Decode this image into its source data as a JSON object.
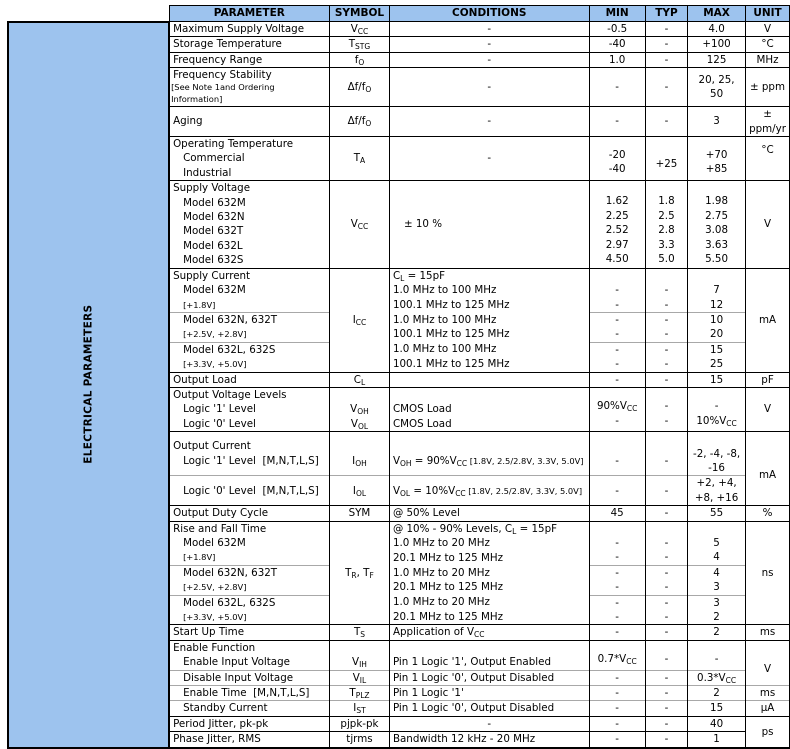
{
  "header": {
    "parameter": "PARAMETER",
    "symbol": "SYMBOL",
    "conditions": "CONDITIONS",
    "min": "MIN",
    "typ": "TYP",
    "max": "MAX",
    "unit": "UNIT"
  },
  "section_label": "ELECTRICAL PARAMETERS",
  "colors": {
    "header_bg": "#9dc3ee",
    "border": "#000000",
    "sub_divider": "#a8a8a8"
  },
  "rows": {
    "max_supply": {
      "param": "Maximum Supply Voltage",
      "sym": "V",
      "sym_sub": "CC",
      "cond": "-",
      "min": "-0.5",
      "typ": "-",
      "max": "4.0",
      "unit": "V"
    },
    "storage_temp": {
      "param": "Storage Temperature",
      "sym": "T",
      "sym_sub": "STG",
      "cond": "-",
      "min": "-40",
      "typ": "-",
      "max": "+100",
      "unit": "°C"
    },
    "freq_range": {
      "param": "Frequency Range",
      "sym": "f",
      "sym_sub": "O",
      "cond": "-",
      "min": "1.0",
      "typ": "-",
      "max": "125",
      "unit": "MHz"
    },
    "freq_stab": {
      "param": "Frequency Stability",
      "note": "[See Note 1and Ordering Information]",
      "sym": "Δf/f",
      "sym_sub": "O",
      "cond": "-",
      "min": "-",
      "typ": "-",
      "max": "20, 25, 50",
      "unit": "± ppm"
    },
    "aging": {
      "param": "Aging",
      "sym": "Δf/f",
      "sym_sub": "O",
      "cond": "-",
      "min": "-",
      "typ": "-",
      "max": "3",
      "unit": "± ppm/yr"
    },
    "op_temp": {
      "param": "Operating Temperature",
      "items": [
        "Commercial",
        "Industrial"
      ],
      "sym": "T",
      "sym_sub": "A",
      "cond": "-",
      "min": [
        "-20",
        "-40"
      ],
      "typ": "+25",
      "max": [
        "+70",
        "+85"
      ],
      "unit": "°C"
    },
    "supply_voltage": {
      "param": "Supply Voltage",
      "models": [
        "Model 632M",
        "Model 632N",
        "Model 632T",
        "Model 632L",
        "Model 632S"
      ],
      "sym": "V",
      "sym_sub": "CC",
      "cond": "± 10 %",
      "min": [
        "1.62",
        "2.25",
        "2.52",
        "2.97",
        "4.50"
      ],
      "typ": [
        "1.8",
        "2.5",
        "2.8",
        "3.3",
        "5.0"
      ],
      "max": [
        "1.98",
        "2.75",
        "3.08",
        "3.63",
        "5.50"
      ],
      "unit": "V"
    },
    "supply_current": {
      "param": "Supply Current",
      "sym": "I",
      "sym_sub": "CC",
      "cond_head": "C",
      "cond_head_sub": "L",
      "cond_head_tail": " = 15pF",
      "unit": "mA",
      "groups": [
        {
          "model": "Model 632M",
          "volt": "[+1.8V]",
          "cond": [
            "1.0 MHz to 100 MHz",
            "100.1 MHz to 125 MHz"
          ],
          "min": [
            "-",
            "-"
          ],
          "typ": [
            "-",
            "-"
          ],
          "max": [
            "7",
            "12"
          ]
        },
        {
          "model": "Model 632N, 632T",
          "volt": "[+2.5V, +2.8V]",
          "cond": [
            "1.0 MHz to 100 MHz",
            "100.1 MHz to 125 MHz"
          ],
          "min": [
            "-",
            "-"
          ],
          "typ": [
            "-",
            "-"
          ],
          "max": [
            "10",
            "20"
          ]
        },
        {
          "model": "Model 632L, 632S",
          "volt": "[+3.3V, +5.0V]",
          "cond": [
            "1.0 MHz to 100 MHz",
            "100.1 MHz to 125 MHz"
          ],
          "min": [
            "-",
            "-"
          ],
          "typ": [
            "-",
            "-"
          ],
          "max": [
            "15",
            "25"
          ]
        }
      ]
    },
    "output_load": {
      "param": "Output Load",
      "sym": "C",
      "sym_sub": "L",
      "cond": "",
      "min": "-",
      "typ": "-",
      "max": "15",
      "unit": "pF"
    },
    "output_voltage": {
      "param": "Output Voltage Levels",
      "unit": "V",
      "items": [
        {
          "label": "Logic '1' Level",
          "sym": "V",
          "sym_sub": "OH",
          "cond": "CMOS Load",
          "min": "90%V",
          "min_sub": "CC",
          "typ": "-",
          "max": "-",
          "max_sub": ""
        },
        {
          "label": "Logic '0' Level",
          "sym": "V",
          "sym_sub": "OL",
          "cond": "CMOS Load",
          "min": "-",
          "min_sub": "",
          "typ": "-",
          "max": "10%V",
          "max_sub": "CC"
        }
      ]
    },
    "output_current": {
      "param": "Output Current",
      "unit": "mA",
      "items": [
        {
          "label": "Logic '1' Level  [M,N,T,L,S]",
          "sym": "I",
          "sym_sub": "OH",
          "cond_a": "V",
          "cond_a_sub": "OH",
          "cond_b": " = 90%V",
          "cond_b_sub": "CC",
          "cond_note": " [1.8V, 2.5/2.8V, 3.3V, 5.0V]",
          "min": "-",
          "typ": "-",
          "max": "-2, -4, -8, -16"
        },
        {
          "label": "Logic '0' Level  [M,N,T,L,S]",
          "sym": "I",
          "sym_sub": "OL",
          "cond_a": "V",
          "cond_a_sub": "OL",
          "cond_b": " = 10%V",
          "cond_b_sub": "CC",
          "cond_note": " [1.8V, 2.5/2.8V, 3.3V, 5.0V]",
          "min": "-",
          "typ": "-",
          "max": "+2, +4, +8, +16"
        }
      ]
    },
    "duty_cycle": {
      "param": "Output Duty Cycle",
      "sym": "SYM",
      "cond": "@ 50% Level",
      "min": "45",
      "typ": "-",
      "max": "55",
      "unit": "%"
    },
    "rise_fall": {
      "param": "Rise and Fall Time",
      "sym": "T",
      "sym_sub": "R",
      "sym_mid": ", T",
      "sym_sub2": "F",
      "cond_head": "@ 10% - 90% Levels, C",
      "cond_head_sub": "L",
      "cond_head_tail": " = 15pF",
      "unit": "ns",
      "groups": [
        {
          "model": "Model 632M",
          "volt": "[+1.8V]",
          "cond": [
            "1.0 MHz to 20 MHz",
            "20.1 MHz to 125 MHz"
          ],
          "min": [
            "-",
            "-"
          ],
          "typ": [
            "-",
            "-"
          ],
          "max": [
            "5",
            "4"
          ]
        },
        {
          "model": "Model 632N, 632T",
          "volt": "[+2.5V, +2.8V]",
          "cond": [
            "1.0 MHz to 20 MHz",
            "20.1 MHz to 125 MHz"
          ],
          "min": [
            "-",
            "-"
          ],
          "typ": [
            "-",
            "-"
          ],
          "max": [
            "4",
            "3"
          ]
        },
        {
          "model": "Model 632L, 632S",
          "volt": "[+3.3V, +5.0V]",
          "cond": [
            "1.0 MHz to 20 MHz",
            "20.1 MHz to 125 MHz"
          ],
          "min": [
            "-",
            "-"
          ],
          "typ": [
            "-",
            "-"
          ],
          "max": [
            "3",
            "2"
          ]
        }
      ]
    },
    "startup": {
      "param": "Start Up Time",
      "sym": "T",
      "sym_sub": "S",
      "cond": "Application of V",
      "cond_sub": "CC",
      "min": "-",
      "typ": "-",
      "max": "2",
      "unit": "ms"
    },
    "enable": {
      "param": "Enable Function",
      "items": [
        {
          "label": "Enable Input Voltage",
          "sym": "V",
          "sym_sub": "IH",
          "cond": "Pin 1 Logic '1', Output Enabled",
          "min": "0.7*V",
          "min_sub": "CC",
          "typ": "-",
          "max": "-",
          "max_sub": "",
          "unit": "V"
        },
        {
          "label": "Disable Input Voltage",
          "sym": "V",
          "sym_sub": "IL",
          "cond": "Pin 1 Logic '0', Output Disabled",
          "min": "-",
          "min_sub": "",
          "typ": "-",
          "max": "0.3*V",
          "max_sub": "CC"
        },
        {
          "label": "Enable Time  [M,N,T,L,S]",
          "sym": "T",
          "sym_sub": "PLZ",
          "cond": "Pin 1 Logic '1'",
          "min": "-",
          "min_sub": "",
          "typ": "-",
          "max": "2",
          "max_sub": "",
          "unit": "ms"
        },
        {
          "label": "Standby Current",
          "sym": "I",
          "sym_sub": "ST",
          "cond": "Pin 1 Logic '0', Output Disabled",
          "min": "-",
          "min_sub": "",
          "typ": "-",
          "max": "15",
          "max_sub": "",
          "unit": "μA"
        }
      ]
    },
    "jitter": {
      "unit": "ps",
      "items": [
        {
          "param": "Period Jitter, pk-pk",
          "sym": "pjpk-pk",
          "cond": "-",
          "min": "-",
          "typ": "-",
          "max": "40"
        },
        {
          "param": "Phase Jitter, RMS",
          "sym": "tjrms",
          "cond": "Bandwidth 12 kHz - 20 MHz",
          "min": "-",
          "typ": "-",
          "max": "1"
        }
      ]
    }
  }
}
